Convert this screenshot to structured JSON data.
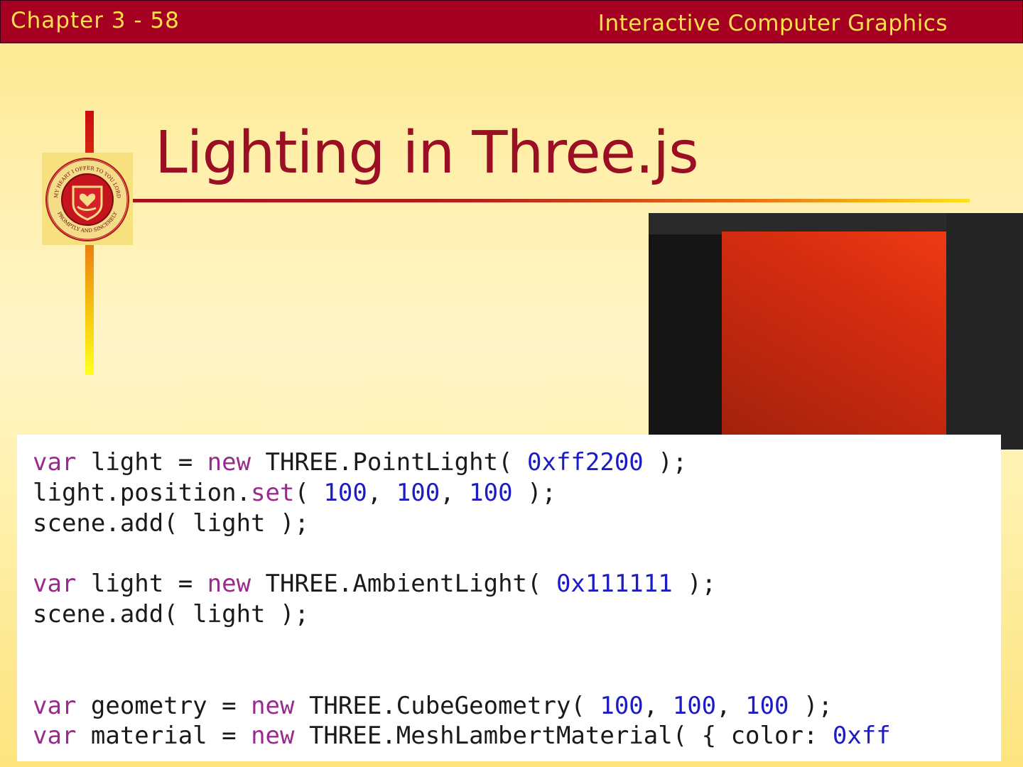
{
  "header": {
    "left_text": "Chapter 3 - 58",
    "right_text": "Interactive Computer Graphics",
    "background_color": "#a50021",
    "text_color": "#ffe14a"
  },
  "slide": {
    "title": "Lighting in Three.js",
    "title_color": "#9b0f25"
  },
  "seal": {
    "ring_text_top": "MY HEART I OFFER TO YOU LORD",
    "ring_text_bottom": "PROMPTLY AND SINCERELY",
    "icon": "heart-in-hand-seal-icon"
  },
  "render_preview": {
    "description_icon": "red-cube-render-icon"
  },
  "code": {
    "lines": [
      {
        "kw1": "var",
        "t1": " light = ",
        "kw2": "new",
        "t2": " THREE.PointLight( ",
        "n1": "0xff2200",
        "t3": " );"
      },
      {
        "t1": "light.position.",
        "kw1": "set",
        "t2": "( ",
        "n1": "100",
        "t3": ", ",
        "n2": "100",
        "t4": ", ",
        "n3": "100",
        "t5": " );"
      },
      {
        "t1": "scene.add( light );"
      },
      {
        "kw1": "var",
        "t1": " light = ",
        "kw2": "new",
        "t2": " THREE.AmbientLight( ",
        "n1": "0x111111",
        "t3": " );"
      },
      {
        "t1": "scene.add( light );"
      },
      {
        "kw1": "var",
        "t1": " geometry = ",
        "kw2": "new",
        "t2": " THREE.CubeGeometry( ",
        "n1": "100",
        "t3": ", ",
        "n2": "100",
        "t4": ", ",
        "n3": "100",
        "t5": " );"
      },
      {
        "kw1": "var",
        "t1": " material = ",
        "kw2": "new",
        "t2": " THREE.MeshLambertMaterial( { color: ",
        "n1": "0xff"
      }
    ],
    "keyword_color": "#9a2a8e",
    "number_color": "#1c1cc4"
  }
}
